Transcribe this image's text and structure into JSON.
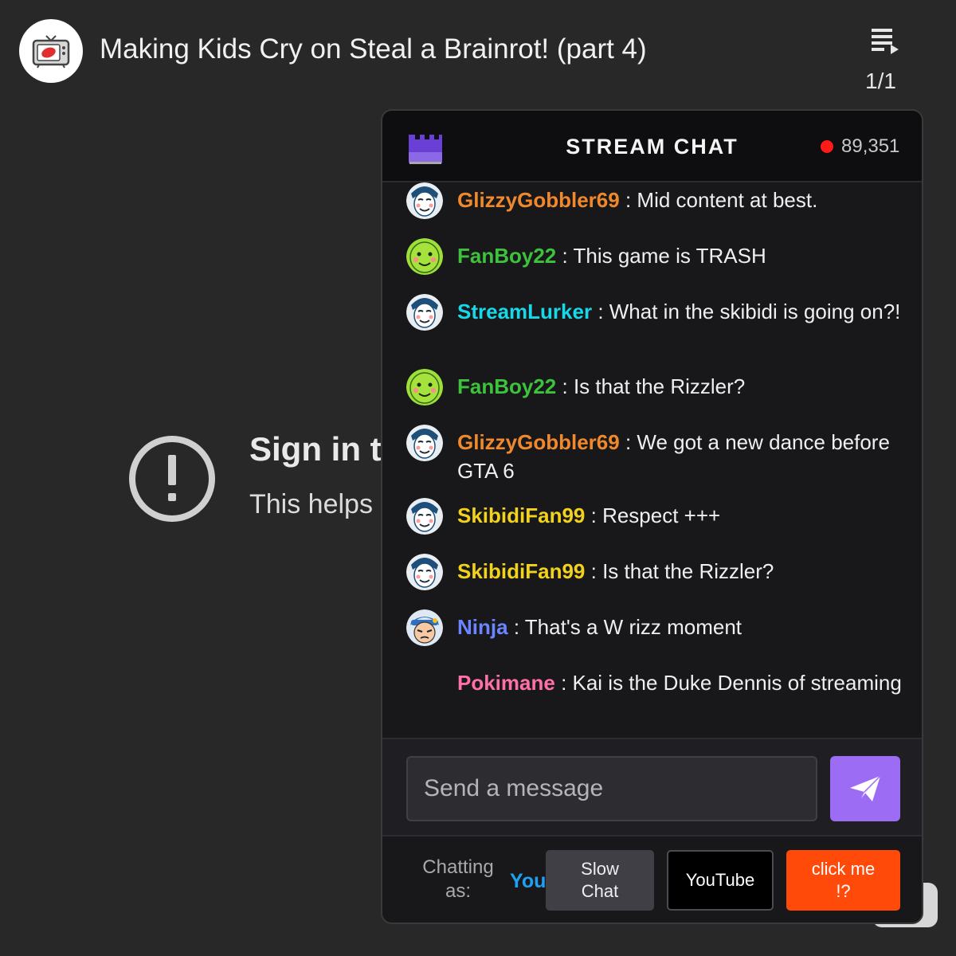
{
  "header": {
    "title": "Making Kids Cry on Steal a Brainrot! (part 4)",
    "playlist_icon": "playlist-play-icon",
    "playlist_position": "1/1"
  },
  "error": {
    "icon": "exclamation-circle-icon",
    "title": "Sign in t",
    "subtitle": "This helps"
  },
  "chat": {
    "title": "STREAM CHAT",
    "viewer_count": "89,351",
    "live_color": "#ff1a1a",
    "messages": [
      {
        "user": "GlizzyGobbler69",
        "text": ": Mid content at best.",
        "avatar": "masked-face-avatar",
        "color": "#f0892c"
      },
      {
        "user": "FanBoy22",
        "text": ": This game is TRASH",
        "avatar": "green-face-avatar",
        "color": "#3dc23b"
      },
      {
        "user": "StreamLurker",
        "text": ": What in the skibidi is going on?!",
        "avatar": "masked-face-avatar",
        "color": "#17d8e8"
      },
      {
        "user": "FanBoy22",
        "text": ": Is that the Rizzler?",
        "avatar": "green-face-avatar",
        "color": "#3dc23b"
      },
      {
        "user": "GlizzyGobbler69",
        "text": ": We got a new dance before GTA 6",
        "avatar": "masked-face-avatar",
        "color": "#f0892c"
      },
      {
        "user": "SkibidiFan99",
        "text": ": Respect +++",
        "avatar": "masked-face-avatar",
        "color": "#f2d21b"
      },
      {
        "user": "SkibidiFan99",
        "text": ": Is that the Rizzler?",
        "avatar": "masked-face-avatar",
        "color": "#f2d21b"
      },
      {
        "user": "Ninja",
        "text": ": That's a W rizz moment",
        "avatar": "ninja-avatar",
        "color": "#6a85ff"
      },
      {
        "user": "Pokimane",
        "text": ": Kai is the Duke Dennis of streaming",
        "avatar": "",
        "color": "#ff6fa8"
      }
    ],
    "input_placeholder": "Send a message",
    "send_icon": "paper-plane-icon",
    "chatting_as_label": "Chatting as:",
    "you_label": "You",
    "buttons": {
      "slow_chat": "Slow Chat",
      "youtube": "YouTube",
      "click_me": "click me !?"
    },
    "accent_color": "#9d6cf4"
  }
}
